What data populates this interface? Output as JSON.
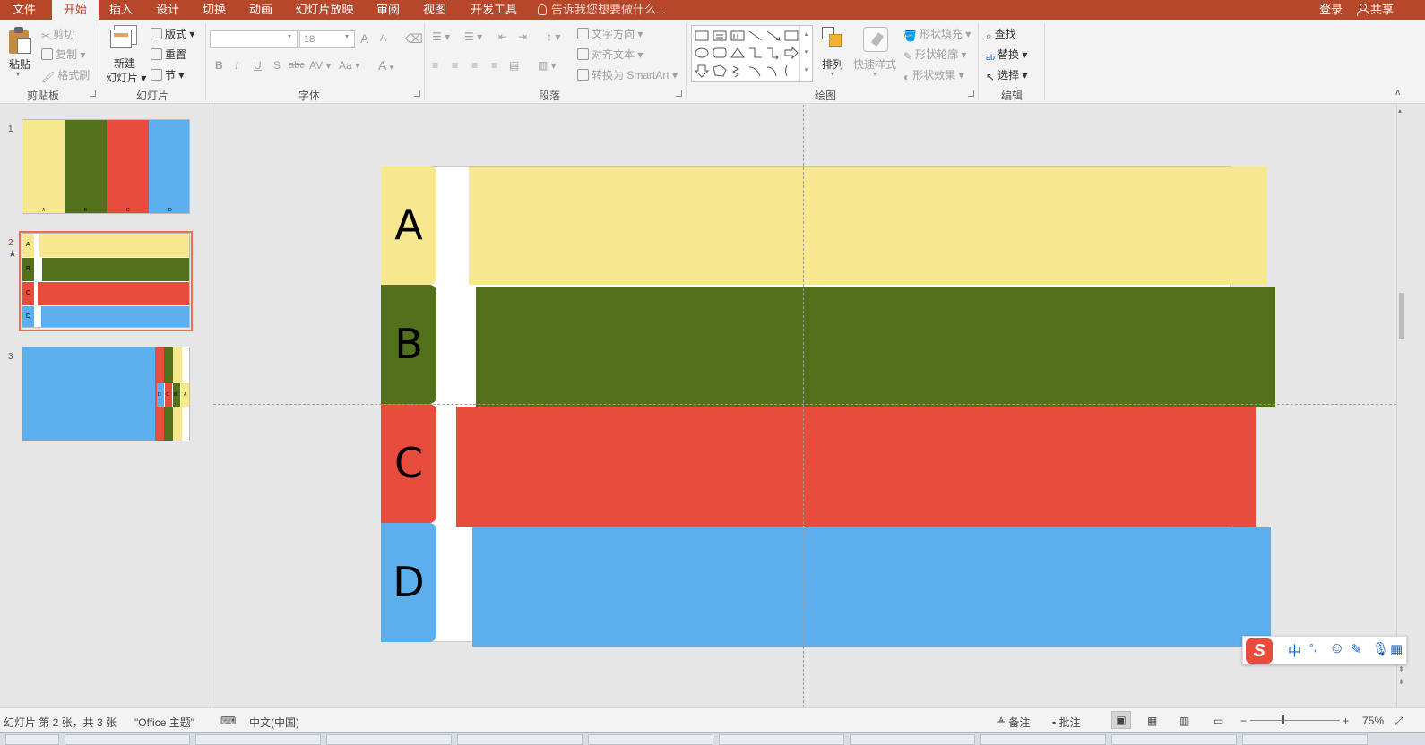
{
  "tabs": [
    "文件",
    "开始",
    "插入",
    "设计",
    "切换",
    "动画",
    "幻灯片放映",
    "审阅",
    "视图",
    "开发工具"
  ],
  "tell_me": "告诉我您想要做什么...",
  "login": "登录",
  "share": "共享",
  "ribbon": {
    "clipboard": {
      "paste": "粘贴",
      "cut": "剪切",
      "copy": "复制",
      "format_painter": "格式刷",
      "label": "剪贴板"
    },
    "slides": {
      "new_slide_line1": "新建",
      "new_slide_line2": "幻灯片",
      "layout": "版式",
      "reset": "重置",
      "section": "节",
      "label": "幻灯片"
    },
    "font": {
      "font_name": "",
      "font_size": "18",
      "bold": "B",
      "italic": "I",
      "underline": "U",
      "shadow": "S",
      "strike": "abc",
      "spacing": "AV",
      "case": "Aa",
      "color": "A",
      "grow": "A",
      "shrink": "A",
      "label": "字体"
    },
    "paragraph": {
      "text_direction": "文字方向",
      "align_text": "对齐文本",
      "smartart": "转换为 SmartArt",
      "label": "段落"
    },
    "drawing": {
      "arrange": "排列",
      "quick_styles": "快速样式",
      "shape_fill": "形状填充",
      "shape_outline": "形状轮廓",
      "shape_effects": "形状效果",
      "label": "绘图"
    },
    "editing": {
      "find": "查找",
      "replace": "替换",
      "select": "选择",
      "label": "编辑"
    }
  },
  "thumbnails": [
    {
      "number": "1",
      "labels": [
        "A",
        "B",
        "C",
        "D"
      ]
    },
    {
      "number": "2",
      "labels": [
        "A",
        "B",
        "C",
        "D"
      ]
    },
    {
      "number": "3",
      "labels": [
        "D",
        "C",
        "B",
        "A"
      ]
    }
  ],
  "slide": {
    "tabs": [
      {
        "letter": "A",
        "color": "#f7e78f"
      },
      {
        "letter": "B",
        "color": "#53711d"
      },
      {
        "letter": "C",
        "color": "#e84c3d"
      },
      {
        "letter": "D",
        "color": "#5daeed"
      }
    ]
  },
  "ime": {
    "logo": "S",
    "mode": "中",
    "punct": "°,",
    "emoji": "☺"
  },
  "status": {
    "slide_info": "幻灯片 第 2 张，共 3 张",
    "theme": "\"Office 主题\"",
    "language": "中文(中国)",
    "notes": "备注",
    "comments": "批注",
    "zoom": "75%"
  }
}
